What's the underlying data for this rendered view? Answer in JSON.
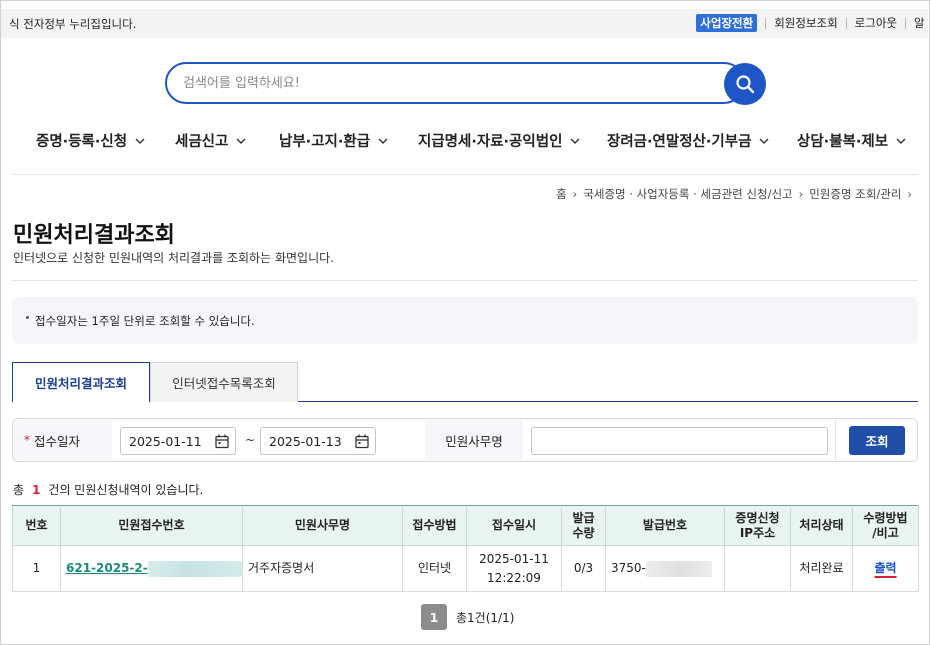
{
  "topbar": {
    "notice": "식 전자정부 누리집입니다.",
    "links": [
      "사업장전환",
      "회원정보조회",
      "로그아웃",
      "알"
    ]
  },
  "search": {
    "placeholder": "검색어를 입력하세요!",
    "icon": "search-icon"
  },
  "gnb": [
    {
      "label": "증명·등록·신청"
    },
    {
      "label": "세금신고"
    },
    {
      "label": "납부·고지·환급"
    },
    {
      "label": "지급명세·자료·공익법인"
    },
    {
      "label": "장려금·연말정산·기부금"
    },
    {
      "label": "상담·불복·제보"
    }
  ],
  "breadcrumb": [
    "홈",
    "국세증명 · 사업자등록 · 세금관련 신청/신고",
    "민원증명 조회/관리"
  ],
  "page": {
    "title": "민원처리결과조회",
    "description": "인터넷으로 신청한 민원내역의 처리결과를 조회하는 화면입니다.",
    "info": "접수일자는 1주일 단위로 조회할 수 있습니다."
  },
  "tabs": [
    {
      "label": "민원처리결과조회",
      "active": true
    },
    {
      "label": "인터넷접수목록조회",
      "active": false
    }
  ],
  "filter": {
    "required_mark": "*",
    "date_label": "접수일자",
    "date_from": "2025-01-11",
    "date_to": "2025-01-13",
    "tilde": "~",
    "name_label": "민원사무명",
    "name_value": "",
    "submit_label": "조회"
  },
  "result": {
    "count_prefix": "총",
    "count": "1",
    "count_suffix": "건의 민원신청내역이 있습니다.",
    "columns": [
      "번호",
      "민원접수번호",
      "민원사무명",
      "접수방법",
      "접수일시",
      "발급\n수량",
      "발급번호",
      "증명신청\nIP주소",
      "처리상태",
      "수령방법\n/비고"
    ],
    "rows": [
      {
        "no": "1",
        "receipt_no": "621-2025-2-",
        "name": "거주자증명서",
        "method": "인터넷",
        "date": "2025-01-11",
        "time": "12:22:09",
        "qty": "0/3",
        "issue_no": "3750-",
        "ip": "",
        "status": "처리완료",
        "action": "출력"
      }
    ]
  },
  "pager": {
    "current": "1",
    "total_text": "총1건(1/1)"
  },
  "colors": {
    "primary": "#1f56c6",
    "navy": "#1f3f8a",
    "accent_red": "#d81e3a",
    "teal_header": "#e8f4f2"
  }
}
